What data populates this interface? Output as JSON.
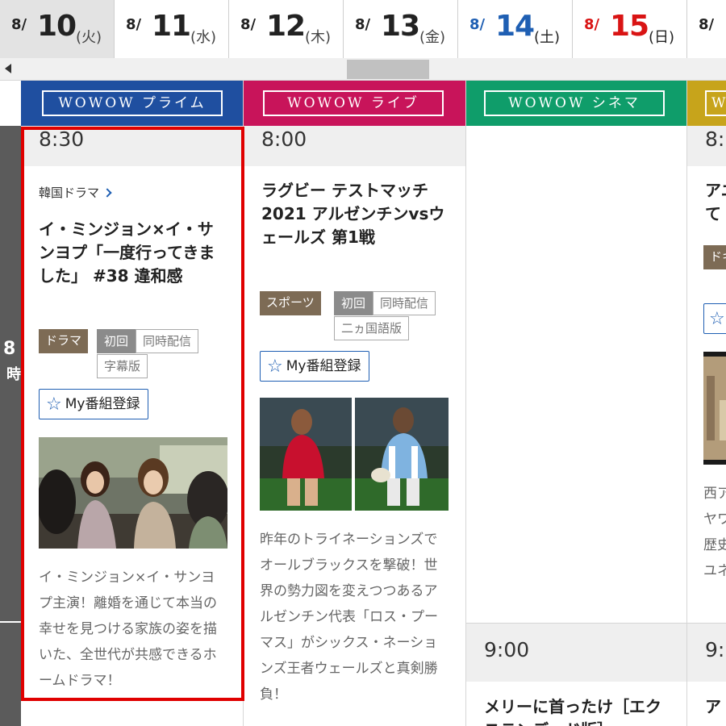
{
  "dates": [
    {
      "month": "8/",
      "day": "10",
      "weekday": "(火)",
      "kind": "weekday",
      "selected": true
    },
    {
      "month": "8/",
      "day": "11",
      "weekday": "(水)",
      "kind": "weekday"
    },
    {
      "month": "8/",
      "day": "12",
      "weekday": "(木)",
      "kind": "weekday"
    },
    {
      "month": "8/",
      "day": "13",
      "weekday": "(金)",
      "kind": "weekday"
    },
    {
      "month": "8/",
      "day": "14",
      "weekday": "(土)",
      "kind": "sat"
    },
    {
      "month": "8/",
      "day": "15",
      "weekday": "(日)",
      "kind": "sun"
    },
    {
      "month": "8/",
      "day": "",
      "weekday": "",
      "kind": "weekday"
    }
  ],
  "time_rail": {
    "hour": "8",
    "unit": "時"
  },
  "colors": {
    "prime": "#1f4fa0",
    "live": "#c8145a",
    "cinema": "#0f9d6a",
    "fourth": "#c7a41b",
    "highlight": "#e00000",
    "link_blue": "#1f5fb3"
  },
  "channels": [
    {
      "name": "WOWOW プライム",
      "time": "8:30",
      "genre_link": "韓国ドラマ",
      "title": "イ・ミンジョン×イ・サンヨプ「一度行ってきました」 #38 違和感",
      "tags": {
        "genre": "ドラマ",
        "first": "初回",
        "simul": "同時配信",
        "sub": "字幕版"
      },
      "mylist_label": "My番組登録",
      "description": "イ・ミンジョン×イ・サンヨプ主演！離婚を通じて本当の幸せを見つける家族の姿を描いた、全世代が共感できるホームドラマ！"
    },
    {
      "name": "WOWOW ライブ",
      "time": "8:00",
      "title": "ラグビー テストマッチ 2021 アルゼンチンvsウェールズ 第1戦",
      "tags": {
        "genre": "スポーツ",
        "first": "初回",
        "simul": "同時配信",
        "dub": "二ヵ国語版"
      },
      "mylist_label": "My番組登録",
      "description": "昨年のトライネーションズでオールブラックスを撃破！世界の勢力図を変えつつあるアルゼンチン代表「ロス・プーマス」がシックス・ネーションズ王者ウェールズと真剣勝負！"
    },
    {
      "name": "WOWOW シネマ",
      "time2": "9:00",
      "title2": "メリーに首ったけ［エクステンデッド版］"
    },
    {
      "name": "W",
      "time": "8:",
      "title_partial": "アニ",
      "title_partial2": "て",
      "tag_partial": "ドキ",
      "desc_partial": [
        "西ア",
        "ヤワ",
        "歴史",
        "ユネ"
      ],
      "time2": "9:",
      "title2_partial": "ア"
    }
  ]
}
